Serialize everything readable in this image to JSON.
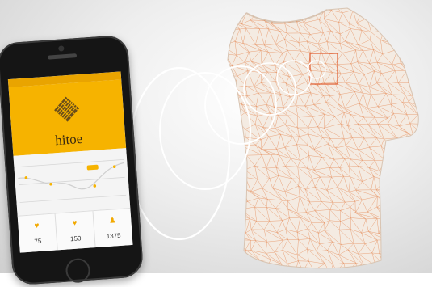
{
  "scene": {
    "background": "#e9e9e9",
    "ring_color": "#ffffff",
    "shirt_color": "#f4ebe2",
    "mesh_color": "#e48a55",
    "sensor_color": "#e2643a"
  },
  "phone": {
    "status_bar": {
      "carrier": "",
      "time": "",
      "battery": ""
    },
    "accent": "#f6b300",
    "brand_name": "hitoe",
    "logo_icon": "diamond-weave-logo",
    "metrics": [
      {
        "icon": "heart-icon",
        "value": "75"
      },
      {
        "icon": "heart-icon",
        "value": "150"
      },
      {
        "icon": "person-icon",
        "value": "1375"
      }
    ]
  }
}
